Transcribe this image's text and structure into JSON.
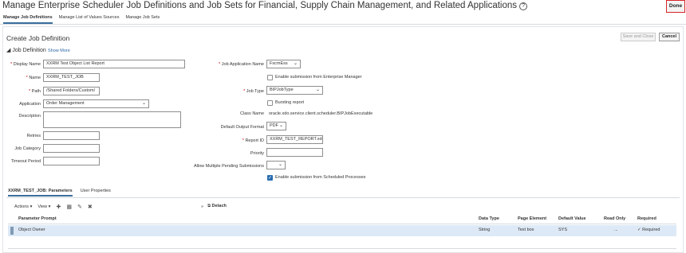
{
  "header": {
    "title": "Manage Enterprise Scheduler Job Definitions and Job Sets for Financial, Supply Chain Management, and Related Applications",
    "help_glyph": "?",
    "done_label": "Done"
  },
  "top_tabs": [
    {
      "label": "Manage Job Definitions"
    },
    {
      "label": "Manage List of Values Sources"
    },
    {
      "label": "Manage Job Sets"
    }
  ],
  "create": {
    "title": "Create Job Definition",
    "save_close_label": "Save and Close",
    "cancel_label": "Cancel",
    "section_label": "Job Definition",
    "show_more_label": "Show More"
  },
  "form": {
    "display_name": {
      "label": "Display Name",
      "value": "XXRM Test Object List Report"
    },
    "name": {
      "label": "Name",
      "value": "XXRM_TEST_JOB"
    },
    "path": {
      "label": "Path",
      "value": "/Shared Folders/Custom/"
    },
    "application": {
      "label": "Application",
      "value": "Order Management"
    },
    "description": {
      "label": "Description",
      "value": ""
    },
    "retries": {
      "label": "Retries",
      "value": ""
    },
    "job_category": {
      "label": "Job Category",
      "value": ""
    },
    "timeout_period": {
      "label": "Timeout Period",
      "value": ""
    },
    "job_application_name": {
      "label": "Job Application Name",
      "value": "FscmEss"
    },
    "enable_em": {
      "label": "Enable submission from Enterprise Manager"
    },
    "job_type": {
      "label": "Job Type",
      "value": "BIPJobType"
    },
    "bursting": {
      "label": "Bursting report"
    },
    "class_name": {
      "label": "Class Name",
      "value": "oracle.xdo.service.client.scheduler.BIPJobExecutable"
    },
    "default_output_format": {
      "label": "Default Output Format",
      "value": "PDF"
    },
    "report_id": {
      "label": "Report ID",
      "value": "XXRM_TEST_REPORT.xdo"
    },
    "priority": {
      "label": "Priority",
      "value": ""
    },
    "allow_multiple": {
      "label": "Allow Multiple Pending Submissions",
      "value": ""
    },
    "enable_scheduled": {
      "label": "Enable submission from Scheduled Processes"
    }
  },
  "lower_tabs": [
    {
      "label": "XXRM_TEST_JOB: Parameters"
    },
    {
      "label": "User Properties"
    }
  ],
  "toolbar": {
    "actions_label": "Actions ▾",
    "view_label": "View ▾",
    "detach_label": "Detach",
    "expand_glyph": "»"
  },
  "grid": {
    "columns": [
      "Parameter Prompt",
      "Data Type",
      "Page Element",
      "Default Value",
      "Read Only",
      "Required"
    ],
    "rows": [
      {
        "prompt": "Object Owner",
        "data_type": "String",
        "page_element": "Text box",
        "default_value": "SYS",
        "read_only": "...",
        "required": "✓ Required"
      }
    ]
  }
}
